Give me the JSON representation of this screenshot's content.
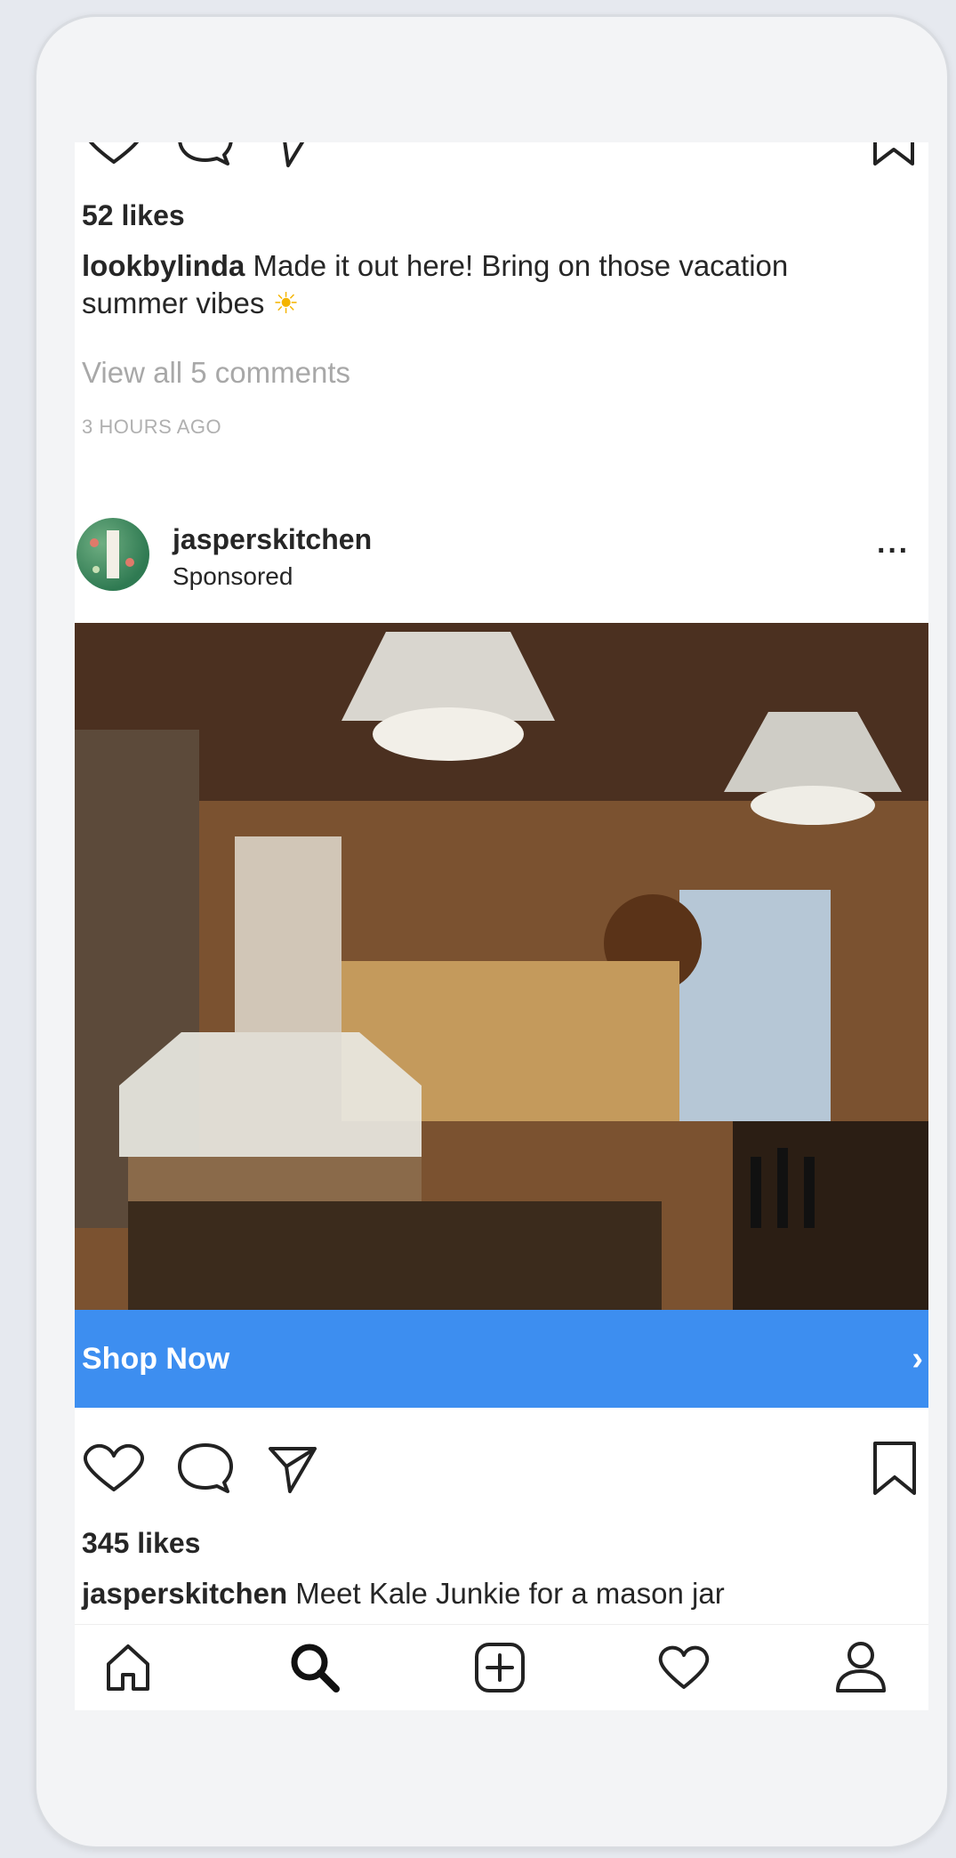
{
  "prev_post": {
    "likes": "52 likes",
    "caption_user": "lookbylinda",
    "caption_text": "Made it out here! Bring on those vacation summer vibes",
    "caption_emoji": "☀",
    "view_comments": "View all 5 comments",
    "timestamp": "3 HOURS AGO"
  },
  "post": {
    "username": "jasperskitchen",
    "sponsored": "Sponsored",
    "more_icon": "more-dots-icon",
    "image_description_icon": "kitchen-photo",
    "cta_label": "Shop Now",
    "cta_arrow": "›",
    "likes": "345 likes",
    "caption_user": "jasperskitchen",
    "caption_text": "Meet Kale Junkie for a mason jar"
  },
  "icons": {
    "like": "heart-icon",
    "comment": "comment-icon",
    "share": "paper-plane-icon",
    "save": "bookmark-icon"
  },
  "nav": {
    "items": [
      "home-icon",
      "search-icon",
      "add-post-icon",
      "activity-heart-icon",
      "profile-icon"
    ]
  },
  "colors": {
    "cta_blue": "#3d8ef0",
    "text": "#262626",
    "muted": "#a8a8a8"
  }
}
